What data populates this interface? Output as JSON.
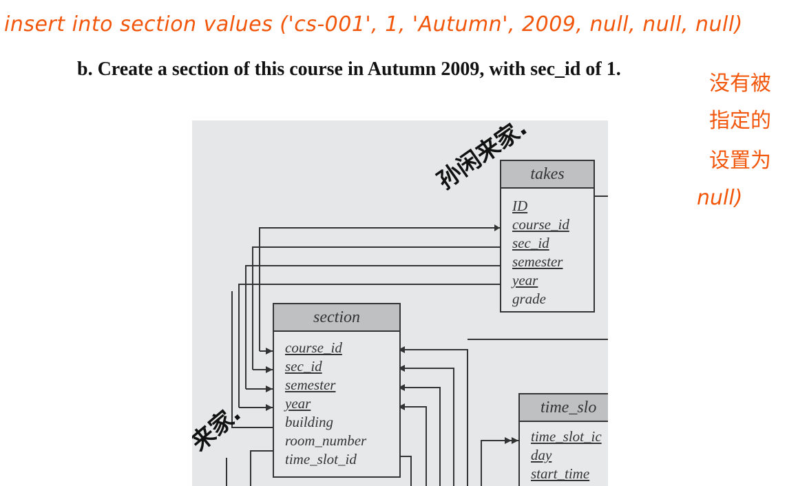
{
  "annotations": {
    "top": "insert into section values ('cs-001', 1, 'Autumn', 2009, null, null, null)",
    "side_lines": [
      "没有被",
      "指定的",
      "设置为",
      "null)"
    ]
  },
  "question": {
    "text": "b. Create a section of this course in Autumn 2009, with sec_id of 1."
  },
  "diagram": {
    "takes": {
      "title": "takes",
      "attributes": [
        "ID",
        "course_id",
        "sec_id",
        "semester",
        "year",
        "grade"
      ]
    },
    "section": {
      "title": "section",
      "attributes": [
        "course_id",
        "sec_id",
        "semester",
        "year",
        "building",
        "room_number",
        "time_slot_id"
      ]
    },
    "time_slot": {
      "title": "time_slo",
      "attributes": [
        "time_slot_ic",
        "day",
        "start_time"
      ]
    },
    "scribbles": [
      "孙闲来家.",
      "来家."
    ],
    "colors": {
      "ink": "#f2560a",
      "paper": "#e6e7e8",
      "header": "#bfc0c2"
    }
  }
}
